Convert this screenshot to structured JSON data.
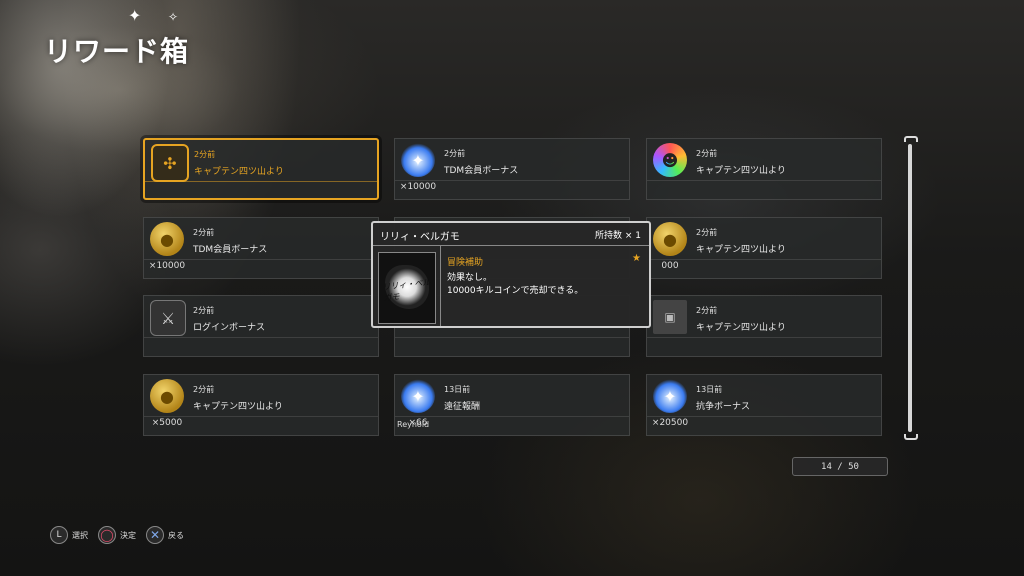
{
  "screen_title": "リワード箱",
  "cards": [
    {
      "time": "2分前",
      "source": "キャプテン四ツ山より",
      "qty": "",
      "player": "",
      "icon": "knot-icon",
      "icon_glyph": "✣",
      "icon_class": "knot",
      "selected": true
    },
    {
      "time": "2分前",
      "source": "TDM会員ボーナス",
      "qty": "×10000",
      "player": "",
      "icon": "blue-flame-icon",
      "icon_glyph": "✦",
      "icon_class": "flame",
      "selected": false
    },
    {
      "time": "2分前",
      "source": "キャプテン四ツ山より",
      "qty": "",
      "player": "",
      "icon": "rainbow-skull-icon",
      "icon_glyph": "☻",
      "icon_class": "rainbow",
      "selected": false
    },
    {
      "time": "2分前",
      "source": "TDM会員ボーナス",
      "qty": "×10000",
      "player": "",
      "icon": "coin-icon",
      "icon_glyph": "●",
      "icon_class": "coin",
      "selected": false
    },
    {
      "time": "",
      "source": "",
      "qty": "",
      "player": "",
      "icon": "",
      "icon_glyph": "",
      "icon_class": "",
      "selected": false
    },
    {
      "time": "2分前",
      "source": "キャプテン四ツ山より",
      "qty": "000",
      "player": "",
      "icon": "coin-icon",
      "icon_glyph": "●",
      "icon_class": "coin",
      "selected": false
    },
    {
      "time": "2分前",
      "source": "ログインボーナス",
      "qty": "",
      "player": "",
      "icon": "cutlery-shield-icon",
      "icon_glyph": "⚔",
      "icon_class": "shield",
      "selected": false
    },
    {
      "time": "",
      "source": "",
      "qty": "",
      "player": "",
      "icon": "",
      "icon_glyph": "",
      "icon_class": "",
      "selected": false
    },
    {
      "time": "2分前",
      "source": "キャプテン四ツ山より",
      "qty": "",
      "player": "",
      "icon": "photo-icon",
      "icon_glyph": "▣",
      "icon_class": "photo",
      "selected": false
    },
    {
      "time": "2分前",
      "source": "キャプテン四ツ山より",
      "qty": "×5000",
      "player": "",
      "icon": "coin-icon",
      "icon_glyph": "●",
      "icon_class": "coin",
      "selected": false
    },
    {
      "time": "13日前",
      "source": "遠征報酬",
      "qty": "×66",
      "player": "Reynold",
      "icon": "blue-flame-icon",
      "icon_glyph": "✦",
      "icon_class": "flame",
      "selected": false
    },
    {
      "time": "13日前",
      "source": "抗争ボーナス",
      "qty": "×20500",
      "player": "",
      "icon": "blue-flame-icon",
      "icon_glyph": "✦",
      "icon_class": "flame",
      "selected": false
    }
  ],
  "detail": {
    "name": "リリィ・ベルガモ",
    "owned": "所持数 × 1",
    "image_caption": "リリィ・ベルガモ",
    "category": "冒険補助",
    "desc_line1": "効果なし。",
    "desc_line2": "10000キルコインで売却できる。"
  },
  "page_counter": "14 / 50",
  "controls": {
    "l_button": "L",
    "o_button": "◯",
    "x_button": "✕",
    "select": "選択",
    "confirm": "決定",
    "back": "戻る"
  }
}
